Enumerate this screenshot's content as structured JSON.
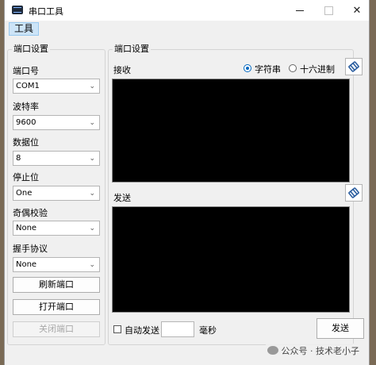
{
  "window": {
    "title": "串口工具",
    "minimize_glyph": "—",
    "close_glyph": "✕"
  },
  "menu": {
    "tools": "工具"
  },
  "left_group": {
    "title": "端口设置",
    "port_label": "端口号",
    "port_value": "COM1",
    "baud_label": "波特率",
    "baud_value": "9600",
    "databits_label": "数据位",
    "databits_value": "8",
    "stopbits_label": "停止位",
    "stopbits_value": "One",
    "parity_label": "奇偶校验",
    "parity_value": "None",
    "handshake_label": "握手协议",
    "handshake_value": "None",
    "refresh_button": "刷新端口",
    "open_button": "打开端口",
    "close_button": "关闭端口"
  },
  "right_group": {
    "title": "端口设置",
    "receive_label": "接收",
    "radio_text": "字符串",
    "radio_hex": "十六进制",
    "send_label": "发送",
    "auto_send_label": "自动发送",
    "ms_label": "毫秒",
    "send_button": "发送"
  },
  "watermark": "公众号 · 技术老小子",
  "colors": {
    "screen": "#000000",
    "accent": "#0067c0",
    "menu_highlight": "#cce4f7"
  },
  "icons": [
    "app-icon",
    "chevron-down-icon",
    "clear-icon",
    "wechat-icon"
  ]
}
